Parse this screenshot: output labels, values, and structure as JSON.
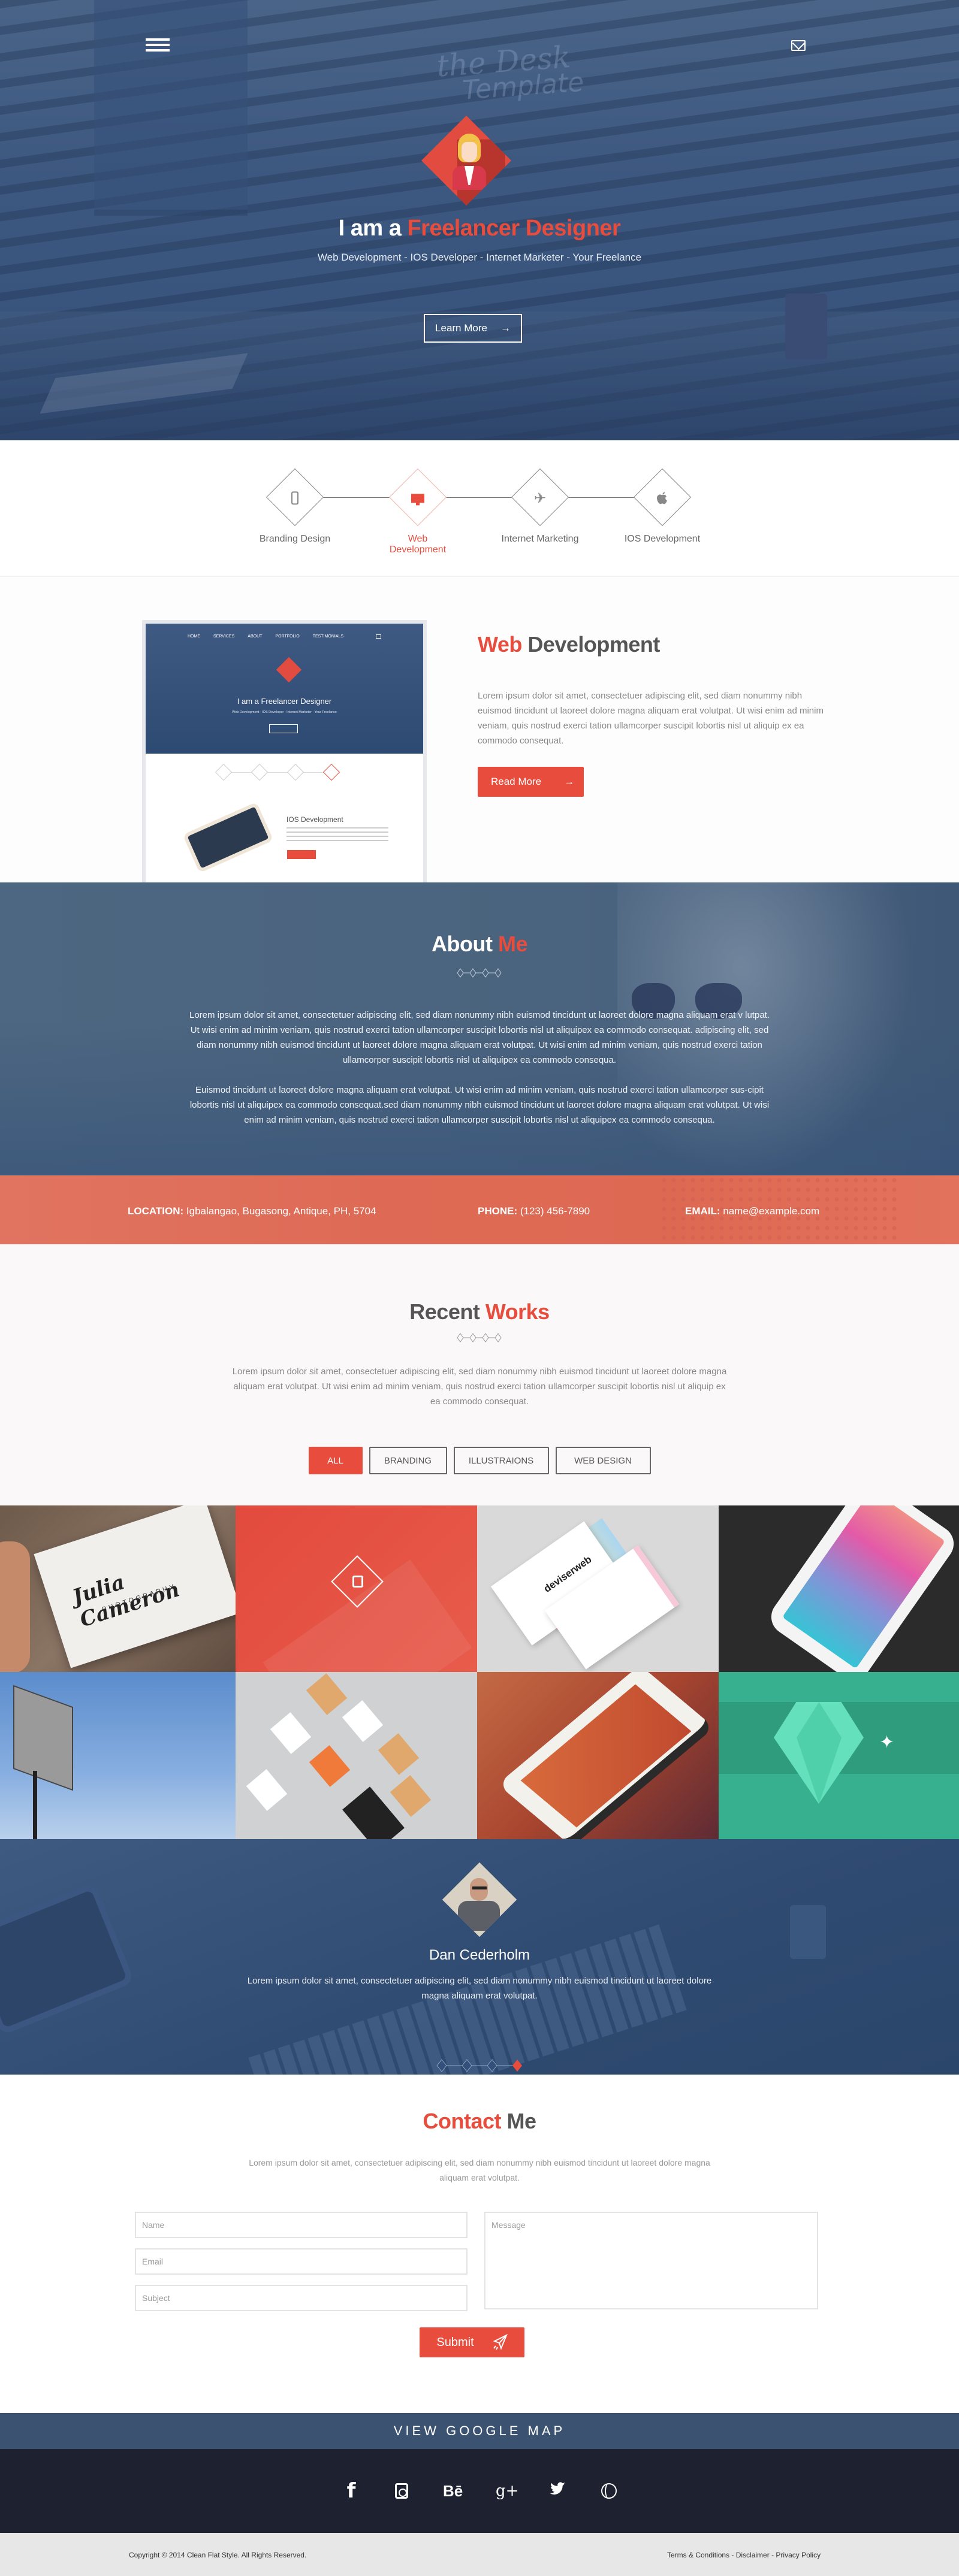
{
  "hero": {
    "menu_icon": "hamburger-menu-icon",
    "mail_icon": "envelope-icon",
    "watermark": [
      "the Desk",
      "Template"
    ],
    "title_prefix": "I am a ",
    "title_highlight": "Freelancer Designer",
    "subtitle": "Web Development - IOS Developer - Internet Marketer - Your Freelance",
    "cta_label": "Learn More",
    "cta_icon": "→"
  },
  "services": {
    "items": [
      {
        "label": "Branding Design",
        "icon": "smartphone-icon",
        "active": false
      },
      {
        "label": "Web Development",
        "icon": "monitor-icon",
        "active": true
      },
      {
        "label": "Internet Marketing",
        "icon": "paper-plane-icon",
        "active": false
      },
      {
        "label": "IOS Development",
        "icon": "apple-icon",
        "active": false
      }
    ]
  },
  "webdev": {
    "title_highlight": "Web",
    "title_rest": " Development",
    "body": "Lorem ipsum dolor sit amet, consectetuer adipiscing elit, sed diam nonummy nibh euismod tincidunt ut laoreet dolore magna aliquam erat volutpat. Ut wisi enim ad minim veniam, quis nostrud exerci tation ullamcorper suscipit lobortis nisl ut aliquip ex ea commodo consequat.",
    "button_label": "Read More",
    "button_icon": "→",
    "mockup": {
      "nav": [
        "HOME",
        "SERVICES",
        "ABOUT",
        "PORTFOLIO",
        "TESTIMONIALS"
      ],
      "title": "I am a Freelancer Designer",
      "subtitle": "Web Development - IOS Developer - Internet Marketer - Your Freelance",
      "heading": "IOS Development"
    }
  },
  "about": {
    "title_a": "About ",
    "title_b": "Me",
    "paragraphs": [
      "Lorem ipsum dolor sit amet, consectetuer adipiscing elit, sed diam nonummy nibh euismod tincidunt ut laoreet dolore magna aliquam erat v lutpat. Ut wisi enim ad minim veniam, quis nostrud exerci tation ullamcorper suscipit lobortis nisl ut aliquipex ea commodo consequat. adipiscing elit, sed diam nonummy nibh euismod tincidunt ut laoreet dolore magna aliquam erat volutpat. Ut wisi enim ad minim veniam, quis nostrud exerci tation ullamcorper suscipit lobortis nisl ut aliquipex ea commodo consequa.",
      "Euismod tincidunt ut laoreet dolore magna aliquam erat volutpat. Ut wisi enim ad minim veniam, quis nostrud exerci tation ullamcorper sus-cipit lobortis nisl ut aliquipex ea commodo consequat.sed diam nonummy nibh euismod tincidunt ut laoreet dolore magna aliquam erat volutpat. Ut wisi enim ad minim veniam, quis nostrud exerci tation ullamcorper suscipit lobortis nisl ut aliquipex ea commodo consequa."
    ]
  },
  "contact_strip": {
    "location_label": "LOCATION:",
    "location_value": " Igbalangao, Bugasong, Antique, PH, 5704",
    "phone_label": "PHONE:",
    "phone_value": " (123) 456-7890",
    "email_label": "EMAIL:",
    "email_value": " name@example.com"
  },
  "works": {
    "title_a": "Recent ",
    "title_b": "Works",
    "body": "Lorem ipsum dolor sit amet, consectetuer adipiscing elit, sed diam nonummy nibh euismod tincidunt ut laoreet dolore magna aliquam erat volutpat. Ut wisi enim ad minim veniam, quis nostrud exerci tation ullamcorper suscipit lobortis nisl ut aliquip ex ea commodo consequat.",
    "filters": [
      {
        "label": "ALL",
        "active": true
      },
      {
        "label": "BRANDING",
        "active": false
      },
      {
        "label": "ILLUSTRAIONS",
        "active": false
      },
      {
        "label": "WEB DESIGN",
        "active": false
      }
    ],
    "tiles": [
      {
        "name": "business-card-julia-cameron",
        "card_name": "Julia Cameron",
        "card_sub": "PHOTOGRAPHY"
      },
      {
        "name": "recipes-red-overlay"
      },
      {
        "name": "deviserweb-business-cards",
        "logo": "deviserweb"
      },
      {
        "name": "dashboard-phone-app"
      },
      {
        "name": "billboard-mockup"
      },
      {
        "name": "stationery-tags-mockup"
      },
      {
        "name": "iphone-mockup"
      },
      {
        "name": "diamond-illustration"
      }
    ]
  },
  "testimonial": {
    "name": "Dan Cederholm",
    "quote": "Lorem ipsum dolor sit amet, consectetuer adipiscing elit, sed diam nonummy nibh euismod tincidunt ut laoreet dolore magna aliquam erat volutpat.",
    "slides": 4,
    "active_slide": 4
  },
  "contact": {
    "title_a": "Contact",
    "title_b": " Me",
    "body": "Lorem ipsum dolor sit amet, consectetuer adipiscing elit, sed diam nonummy nibh euismod tincidunt ut laoreet dolore magna aliquam erat volutpat.",
    "name_placeholder": "Name",
    "email_placeholder": "Email",
    "subject_placeholder": "Subject",
    "message_placeholder": "Message",
    "submit_label": "Submit"
  },
  "map": {
    "label": "VIEW GOOGLE MAP"
  },
  "social": [
    {
      "name": "facebook-icon",
      "glyph": "f"
    },
    {
      "name": "instagram-icon",
      "glyph": ""
    },
    {
      "name": "behance-icon",
      "glyph": "Bē"
    },
    {
      "name": "google-plus-icon",
      "glyph": "g+"
    },
    {
      "name": "twitter-icon",
      "glyph": "🐦"
    },
    {
      "name": "dribbble-icon",
      "glyph": ""
    }
  ],
  "footer": {
    "copyright": "Copyright © 2014 Clean Flat Style. All Rights Reserved.",
    "links": [
      "Terms & Conditions",
      "Disclaimer",
      "Privacy Policy"
    ],
    "separator": " - "
  },
  "colors": {
    "accent": "#e74c3c",
    "navy": "#3b5270",
    "footer_dark": "#1d2130",
    "text_gray": "#555555"
  }
}
